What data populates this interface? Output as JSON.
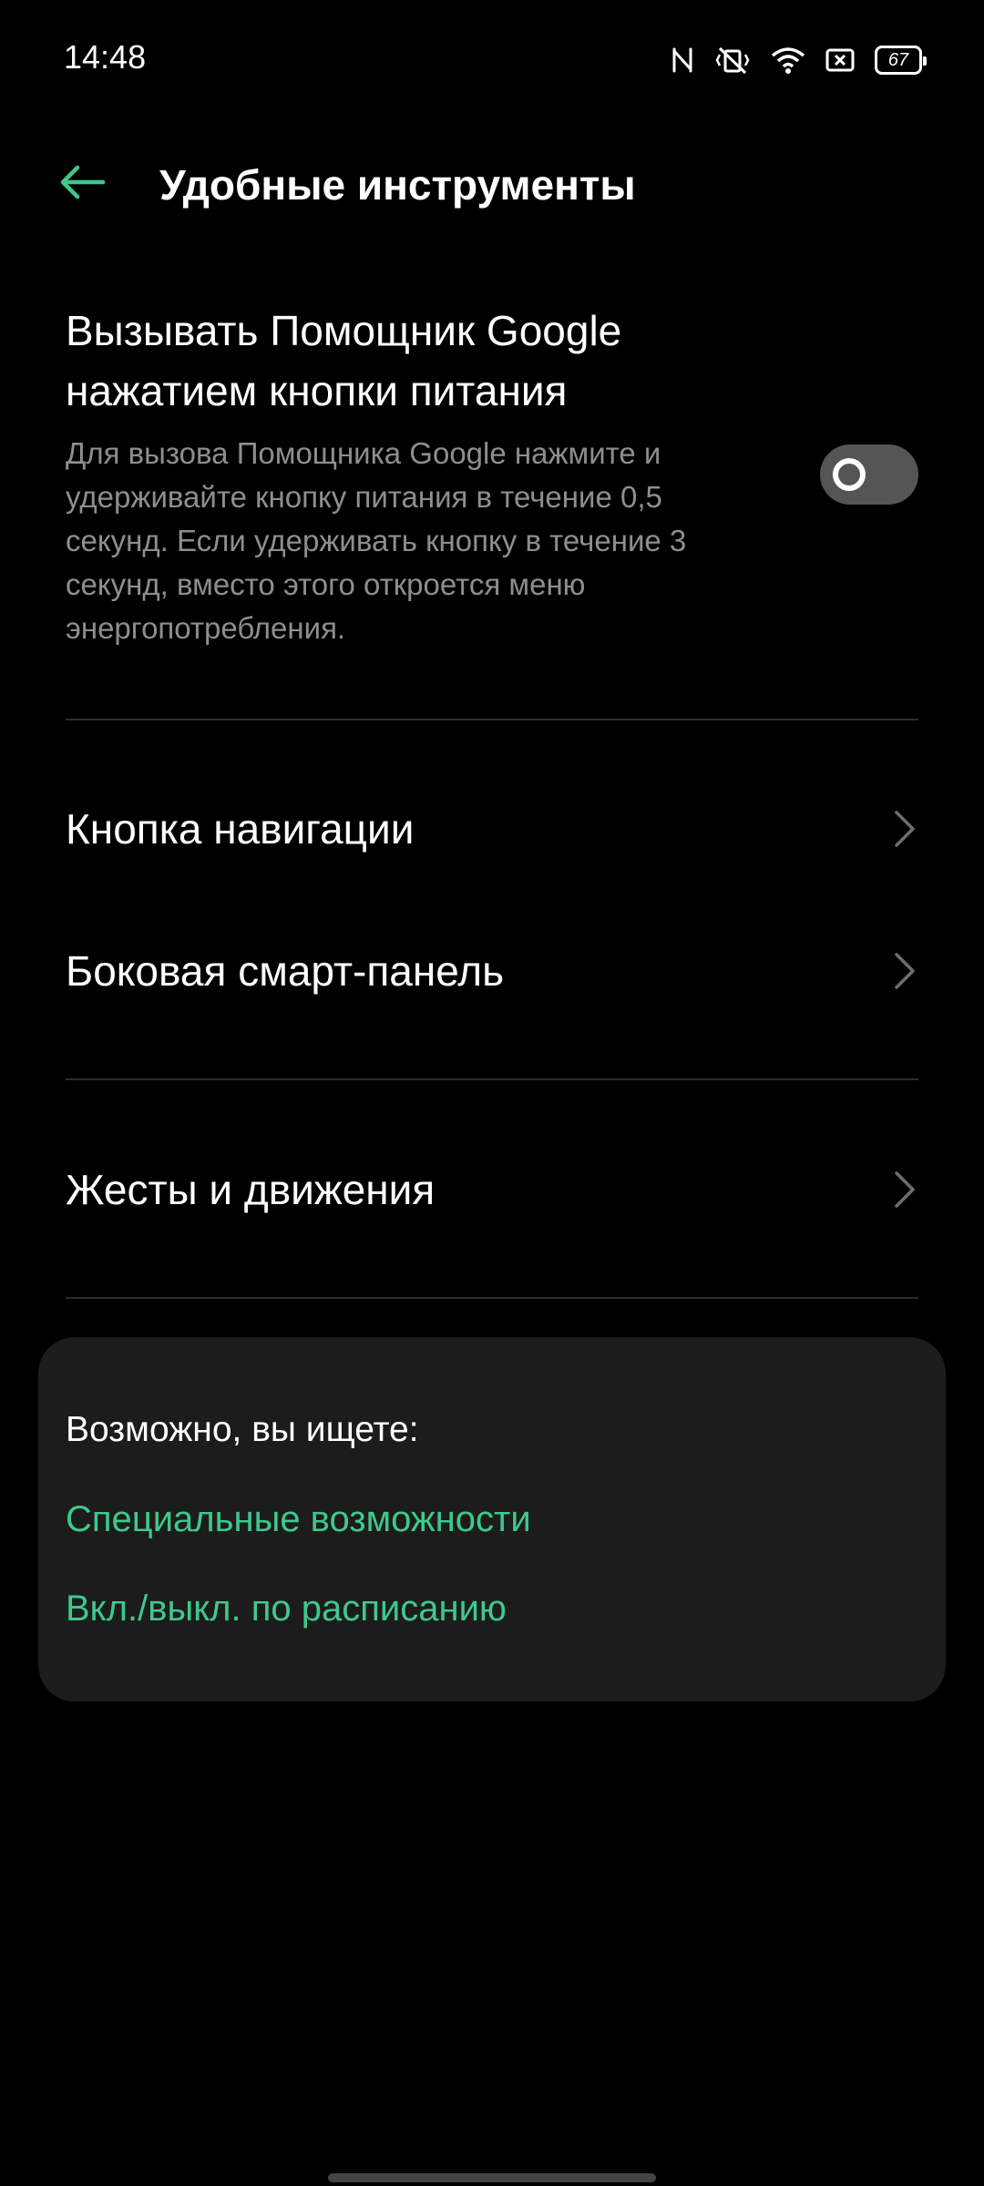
{
  "status_bar": {
    "time": "14:48",
    "battery_level": "67",
    "icons": [
      "nfc-icon",
      "vibrate-off-icon",
      "wifi-icon",
      "sim-card-icon",
      "battery-icon"
    ]
  },
  "header": {
    "title": "Удобные инструменты"
  },
  "assistant_setting": {
    "title": "Вызывать Помощник Google нажатием кнопки питания",
    "description": "Для вызова Помощника Google нажмите и удерживайте кнопку питания в течение 0,5 секунд. Если удерживать кнопку в течение 3 секунд, вместо этого откроется меню энергопотребления.",
    "enabled": false
  },
  "nav_items": [
    {
      "label": "Кнопка навигации"
    },
    {
      "label": "Боковая смарт-панель"
    },
    {
      "label": "Жесты и движения"
    }
  ],
  "suggestions": {
    "heading": "Возможно, вы ищете:",
    "links": [
      {
        "label": "Специальные возможности"
      },
      {
        "label": "Вкл./выкл. по расписанию"
      }
    ]
  },
  "colors": {
    "accent": "#3ec98c",
    "background": "#000000",
    "card": "#1c1c1c",
    "secondary_text": "#8e8e8e"
  }
}
